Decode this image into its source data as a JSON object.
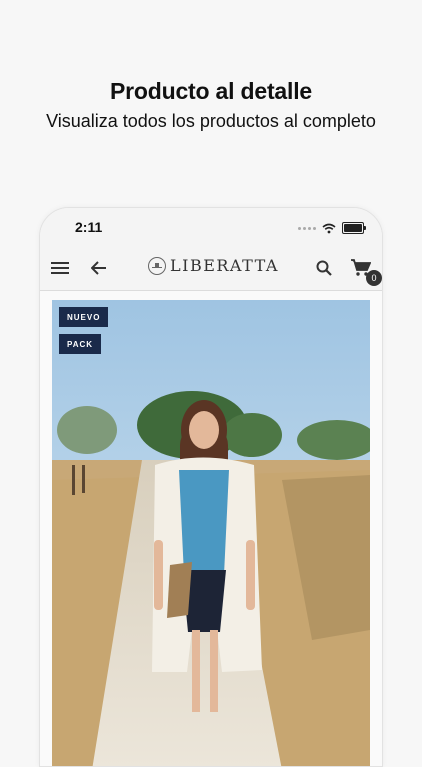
{
  "promo": {
    "title": "Producto al detalle",
    "subtitle": "Visualiza todos los productos al completo"
  },
  "status_bar": {
    "time": "2:11"
  },
  "app_bar": {
    "brand": "LIBERATTA",
    "cart_count": "0",
    "icons": [
      "menu-icon",
      "back-arrow-icon",
      "search-icon",
      "cart-icon"
    ]
  },
  "product": {
    "badges": [
      "NUEVO",
      "PACK"
    ]
  }
}
